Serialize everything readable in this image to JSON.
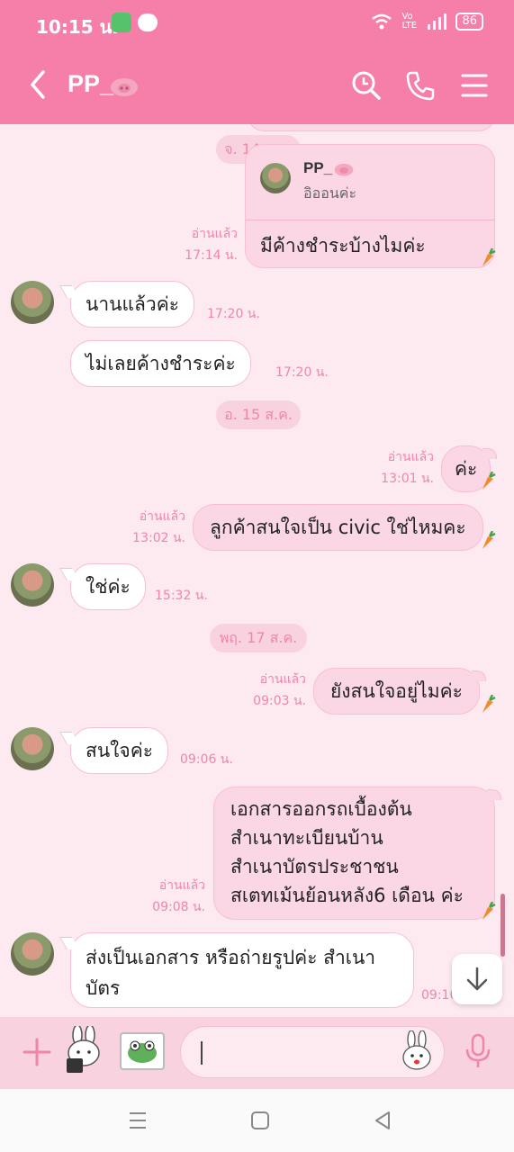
{
  "status": {
    "time": "10:15 น.",
    "battery": "86",
    "network": "Vo LTE"
  },
  "header": {
    "title": "PP_"
  },
  "reply": {
    "date": "จ. 14 ส.ค.",
    "name": "PP_",
    "quote": "อิออนค่ะ",
    "text": "มีค้างชำระบ้างไมค่ะ",
    "read": "อ่านแล้ว",
    "time": "17:14 น."
  },
  "messages": [
    {
      "text": "นานแล้วค่ะ",
      "time": "17:20 น."
    },
    {
      "text": "ไม่เลยค้างชำระค่ะ",
      "time": "17:20 น."
    },
    {
      "date": "อ. 15 ส.ค."
    },
    {
      "text": "ค่ะ",
      "read": "อ่านแล้ว",
      "time": "13:01 น."
    },
    {
      "text": "ลูกค้าสนใจเป็น civic ใช่ไหมคะ",
      "read": "อ่านแล้ว",
      "time": "13:02 น."
    },
    {
      "text": "ใช่ค่ะ",
      "time": "15:32 น."
    },
    {
      "date": "พฤ. 17 ส.ค."
    },
    {
      "text": "ยังสนใจอยู่ไมค่ะ",
      "read": "อ่านแล้ว",
      "time": "09:03 น."
    },
    {
      "text": "สนใจค่ะ",
      "time": "09:06 น."
    },
    {
      "lines": [
        "เอกสารออกรถเบื้องต้น",
        "สำเนาทะเบียนบ้าน",
        "สำเนาบัตรประชาชน",
        "สเตทเม้นย้อนหลัง6 เดือน ค่ะ"
      ],
      "read": "อ่านแล้ว",
      "time": "09:08 น."
    },
    {
      "text": "ส่งเป็นเอกสาร หรือถ่ายรูปค่ะ สำเนาบัตร",
      "time": "09:16"
    }
  ],
  "icons": {
    "back": "chevron-left-icon",
    "search": "search-icon",
    "call": "phone-icon",
    "menu": "hamburger-menu-icon",
    "plus": "plus-icon",
    "mic": "microphone-icon",
    "scroll": "arrow-down-icon"
  },
  "colors": {
    "header": "#f57fa8",
    "chat_bg": "#fde9f0",
    "out_bubble": "#fbd6e4",
    "accent_text": "#ef86a8"
  }
}
